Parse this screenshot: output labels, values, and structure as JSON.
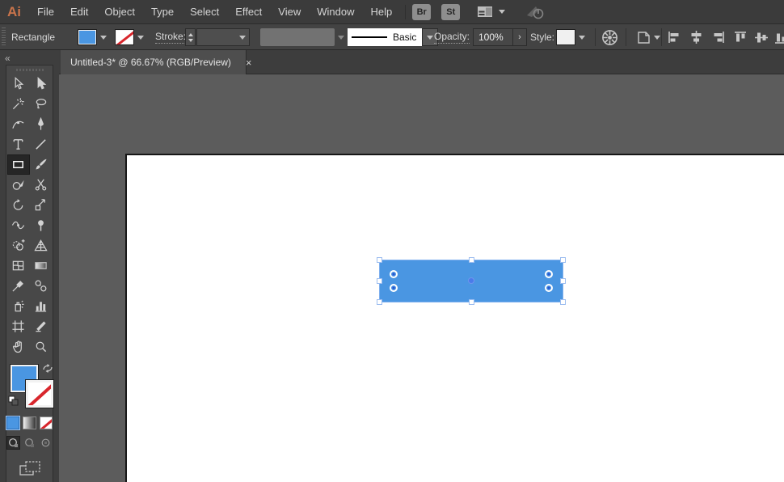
{
  "app": {
    "logo_label": "Ai"
  },
  "menu_bar": {
    "items": [
      "File",
      "Edit",
      "Object",
      "Type",
      "Select",
      "Effect",
      "View",
      "Window",
      "Help"
    ],
    "bridge_label": "Br",
    "stock_label": "St"
  },
  "control_bar": {
    "context_label": "Rectangle",
    "stroke_label": "Stroke:",
    "brush_definition": "Basic",
    "opacity_label": "Opacity:",
    "opacity_value": "100%",
    "opacity_arrow": "›",
    "style_label": "Style:"
  },
  "tab_bar": {
    "active_tab_title": "Untitled-3* @ 66.67% (RGB/Preview)",
    "close_glyph": "×"
  },
  "toolbar": {
    "collapse_glyph": "«"
  },
  "canvas": {
    "zoom_level": "66.67%",
    "color_mode": "RGB/Preview",
    "artboard_color": "#ffffff",
    "selected_object": {
      "type": "rectangle",
      "fill_color": "#4a96e2",
      "stroke": "none"
    }
  },
  "colors": {
    "accent_blue": "#4a96e2",
    "none_red": "#d8262c",
    "ui_dark": "#3b3b3b"
  }
}
